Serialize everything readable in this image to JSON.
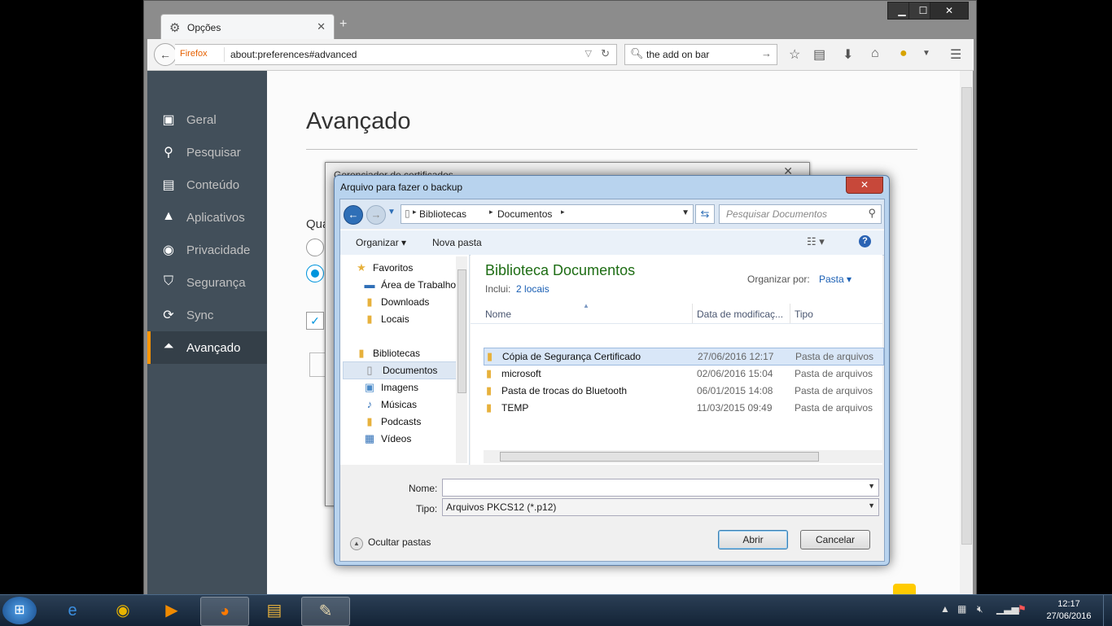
{
  "browser": {
    "tab_title": "Opções",
    "url_identity": "Firefox",
    "url": "about:preferences#advanced",
    "search_value": "the add on bar"
  },
  "prefs": {
    "nav": [
      {
        "label": "Geral",
        "icon": "general-icon"
      },
      {
        "label": "Pesquisar",
        "icon": "search-icon"
      },
      {
        "label": "Conteúdo",
        "icon": "document-icon"
      },
      {
        "label": "Aplicativos",
        "icon": "rocket-icon"
      },
      {
        "label": "Privacidade",
        "icon": "mask-icon"
      },
      {
        "label": "Segurança",
        "icon": "lock-icon"
      },
      {
        "label": "Sync",
        "icon": "sync-icon"
      },
      {
        "label": "Avançado",
        "icon": "wizard-icon"
      }
    ],
    "active": "Avançado",
    "title": "Avançado",
    "partial_label": "Qua"
  },
  "cert_manager": {
    "title": "Gerenciador de certificados"
  },
  "dialog": {
    "title": "Arquivo para fazer o backup",
    "breadcrumb": [
      "Bibliotecas",
      "Documentos"
    ],
    "search_placeholder": "Pesquisar Documentos",
    "organize_label": "Organizar",
    "new_folder_label": "Nova pasta",
    "tree": {
      "favorites_label": "Favoritos",
      "favorites": [
        "Área de Trabalho",
        "Downloads",
        "Locais"
      ],
      "libraries_label": "Bibliotecas",
      "libraries": [
        "Documentos",
        "Imagens",
        "Músicas",
        "Podcasts",
        "Vídeos"
      ],
      "selected": "Documentos"
    },
    "library_title": "Biblioteca Documentos",
    "includes_label": "Inclui:",
    "includes_link": "2 locais",
    "arrange_label": "Organizar por:",
    "arrange_value": "Pasta",
    "columns": [
      "Nome",
      "Data de modificaç...",
      "Tipo"
    ],
    "files": [
      {
        "name": "Cópia de Segurança Certificado",
        "date": "27/06/2016 12:17",
        "type": "Pasta de arquivos",
        "selected": true
      },
      {
        "name": "microsoft",
        "date": "02/06/2016 15:04",
        "type": "Pasta de arquivos",
        "selected": false
      },
      {
        "name": "Pasta de trocas do Bluetooth",
        "date": "06/01/2015 14:08",
        "type": "Pasta de arquivos",
        "selected": false
      },
      {
        "name": "TEMP",
        "date": "11/03/2015 09:49",
        "type": "Pasta de arquivos",
        "selected": false
      }
    ],
    "name_label": "Nome:",
    "name_value": "",
    "type_label": "Tipo:",
    "type_value": "Arquivos PKCS12 (*.p12)",
    "hide_folders_label": "Ocultar pastas",
    "open_label": "Abrir",
    "cancel_label": "Cancelar"
  },
  "taskbar": {
    "time": "12:17",
    "date": "27/06/2016"
  }
}
